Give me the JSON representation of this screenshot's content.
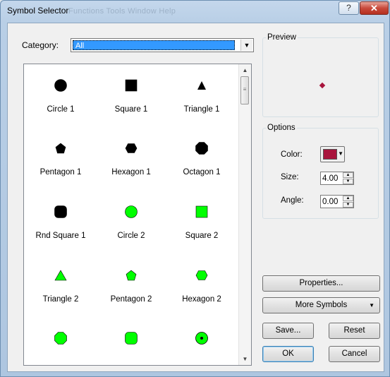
{
  "window": {
    "title": "Symbol Selector",
    "ghost_menu": "Functions  Tools  Window  Help",
    "help_glyph": "?",
    "close_glyph": "✕"
  },
  "category": {
    "label": "Category:",
    "value": "All"
  },
  "symbols": [
    {
      "name": "Circle 1",
      "shape": "circle",
      "fill": "#000000"
    },
    {
      "name": "Square 1",
      "shape": "square",
      "fill": "#000000"
    },
    {
      "name": "Triangle 1",
      "shape": "triangle-small",
      "fill": "#000000"
    },
    {
      "name": "Pentagon 1",
      "shape": "pentagon",
      "fill": "#000000"
    },
    {
      "name": "Hexagon 1",
      "shape": "hexagon",
      "fill": "#000000"
    },
    {
      "name": "Octagon 1",
      "shape": "octagon",
      "fill": "#000000"
    },
    {
      "name": "Rnd Square 1",
      "shape": "rounded-square",
      "fill": "#000000"
    },
    {
      "name": "Circle 2",
      "shape": "circle",
      "fill": "#00ff00"
    },
    {
      "name": "Square 2",
      "shape": "square",
      "fill": "#00ff00"
    },
    {
      "name": "Triangle 2",
      "shape": "triangle",
      "fill": "#00ff00"
    },
    {
      "name": "Pentagon 2",
      "shape": "pentagon",
      "fill": "#00ff00"
    },
    {
      "name": "Hexagon 2",
      "shape": "hexagon",
      "fill": "#00ff00"
    },
    {
      "name": "",
      "shape": "octagon",
      "fill": "#00ff00"
    },
    {
      "name": "",
      "shape": "rounded-square",
      "fill": "#00ff00"
    },
    {
      "name": "",
      "shape": "circle-dot",
      "fill": "#00ff00"
    }
  ],
  "preview": {
    "legend": "Preview",
    "marker_color": "#a8143c"
  },
  "options": {
    "legend": "Options",
    "color_label": "Color:",
    "color_value": "#a8143c",
    "size_label": "Size:",
    "size_value": "4.00",
    "angle_label": "Angle:",
    "angle_value": "0.00"
  },
  "buttons": {
    "properties": "Properties...",
    "more_symbols": "More Symbols",
    "save": "Save...",
    "reset": "Reset",
    "ok": "OK",
    "cancel": "Cancel"
  }
}
